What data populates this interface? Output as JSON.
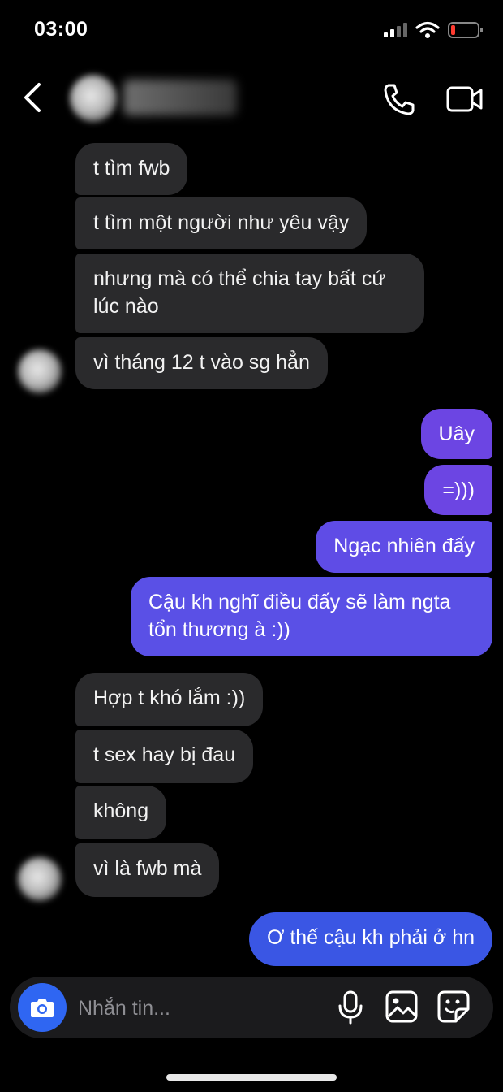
{
  "status_bar": {
    "time": "03:00"
  },
  "header": {
    "contact_name": "",
    "back_icon": "chevron-left-icon",
    "call_icon": "phone-icon",
    "video_icon": "video-camera-icon"
  },
  "messages": [
    {
      "from": "them",
      "text": "t tìm fwb"
    },
    {
      "from": "them",
      "text": "t tìm một người như yêu vậy"
    },
    {
      "from": "them",
      "text": "nhưng mà có thể chia tay bất cứ\nlúc nào"
    },
    {
      "from": "them",
      "text": "vì tháng 12 t vào sg hẳn"
    },
    {
      "from": "me",
      "text": "Uây"
    },
    {
      "from": "me",
      "text": "=)))"
    },
    {
      "from": "me",
      "text": "Ngạc nhiên đấy"
    },
    {
      "from": "me",
      "text": "Cậu kh nghĩ điều đấy sẽ làm ngta\ntổn thương à :))"
    },
    {
      "from": "them",
      "text": "Hợp t khó lắm :))"
    },
    {
      "from": "them",
      "text": "t sex hay bị đau"
    },
    {
      "from": "them",
      "text": "không"
    },
    {
      "from": "them",
      "text": "vì là fwb mà"
    },
    {
      "from": "me",
      "text": "Ơ thế cậu kh phải ở hn"
    }
  ],
  "composer": {
    "placeholder": "Nhắn tin...",
    "camera_icon": "camera-icon",
    "mic_icon": "microphone-icon",
    "gallery_icon": "image-icon",
    "sticker_icon": "sticker-icon"
  },
  "colors": {
    "background": "#000000",
    "incoming_bubble": "#2a2a2c",
    "outgoing_purple": "#6c45e3",
    "outgoing_blue": "#3a56e4",
    "accent": "#2f66f2"
  }
}
